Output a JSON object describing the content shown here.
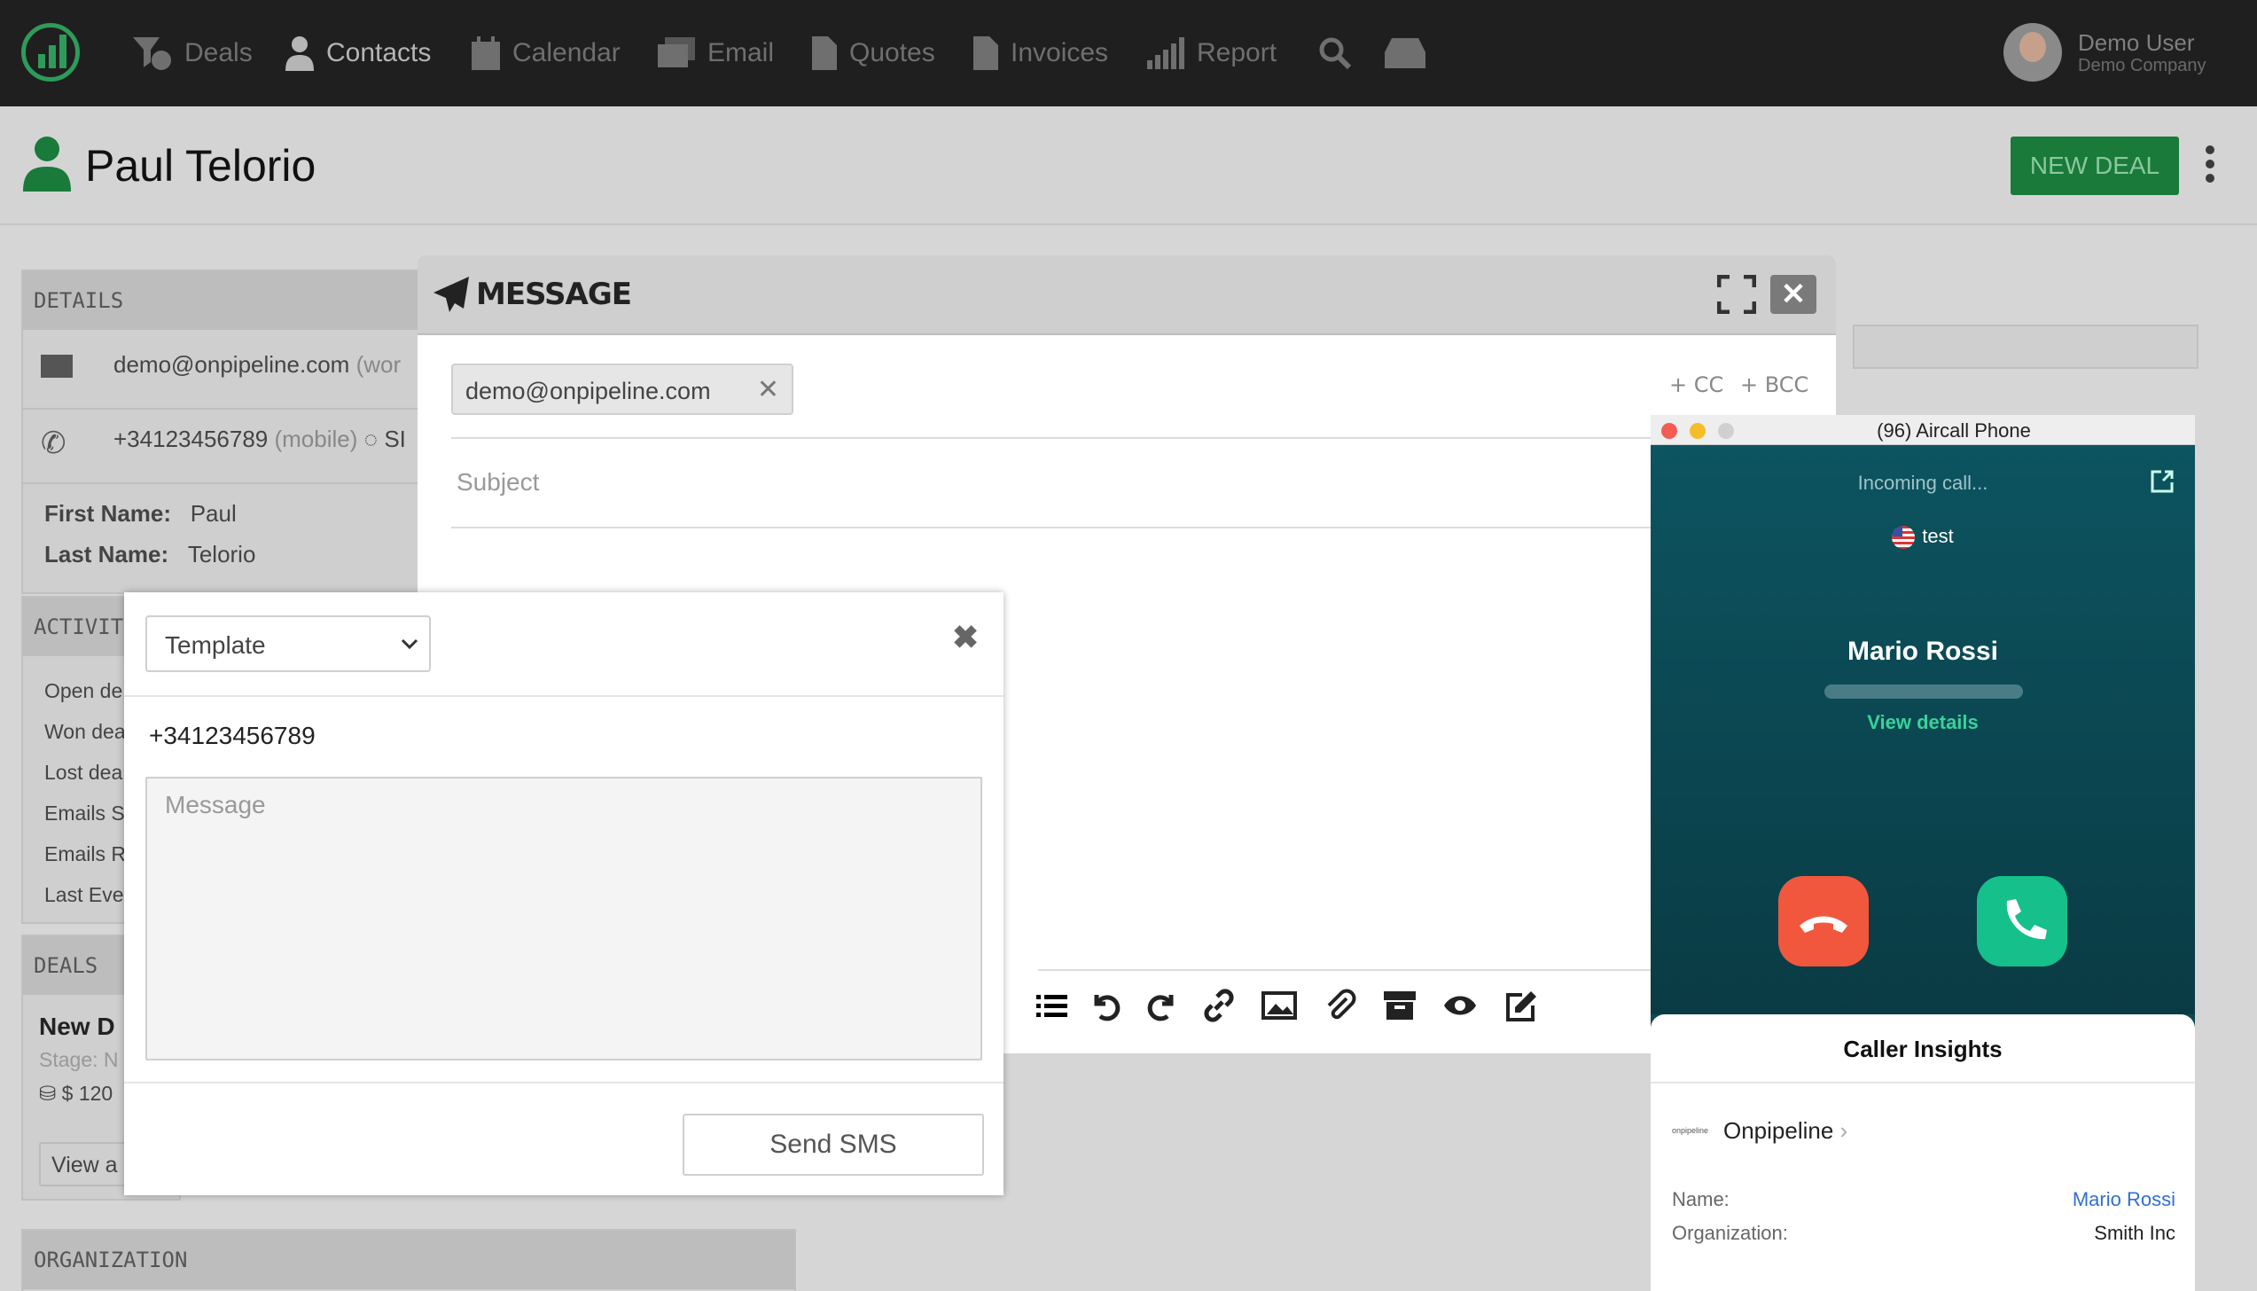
{
  "nav": {
    "items": [
      {
        "label": "Deals",
        "icon": "deals-icon"
      },
      {
        "label": "Contacts",
        "icon": "user-icon"
      },
      {
        "label": "Calendar",
        "icon": "calendar-icon"
      },
      {
        "label": "Email",
        "icon": "email-icon"
      },
      {
        "label": "Quotes",
        "icon": "quote-icon"
      },
      {
        "label": "Invoices",
        "icon": "invoice-icon"
      },
      {
        "label": "Report",
        "icon": "report-icon"
      }
    ],
    "user_name": "Demo User",
    "user_company": "Demo Company"
  },
  "header": {
    "contact_name": "Paul Telorio",
    "new_deal_label": "NEW DEAL"
  },
  "details": {
    "title": "DETAILS",
    "email": "demo@onpipeline.com",
    "email_type": "(wor",
    "phone": "+34123456789",
    "phone_type": "(mobile)",
    "sms_label": "SI",
    "first_name_label": "First Name:",
    "first_name": "Paul",
    "last_name_label": "Last Name:",
    "last_name": "Telorio"
  },
  "activities": {
    "title": "ACTIVITIES",
    "rows": [
      "Open de",
      "Won dea",
      "Lost dea",
      "Emails S",
      "Emails R",
      "Last Eve"
    ]
  },
  "deals": {
    "title": "DEALS",
    "name": "New D",
    "stage": "Stage: N",
    "amount": "$ 120",
    "view_all": "View a"
  },
  "organization": {
    "title": "ORGANIZATION"
  },
  "message": {
    "title": "MESSAGE",
    "to_chip": "demo@onpipeline.com",
    "cc": "+ CC",
    "bcc": "+ BCC",
    "subject_placeholder": "Subject"
  },
  "sms": {
    "template_label": "Template",
    "phone": "+34123456789",
    "message_placeholder": "Message",
    "send_label": "Send SMS"
  },
  "aircall": {
    "window_title": "(96) Aircall Phone",
    "status": "Incoming call...",
    "tag": "test",
    "caller_name": "Mario Rossi",
    "view_details": "View details",
    "insights_title": "Caller Insights",
    "org_logo_text": "onpipeline",
    "org_name": "Onpipeline",
    "name_label": "Name:",
    "name_value": "Mario Rossi",
    "org_label": "Organization:",
    "org_value": "Smith Inc"
  },
  "colors": {
    "brand_green": "#197a3a",
    "decline": "#f1573c",
    "accept": "#15c08a"
  }
}
